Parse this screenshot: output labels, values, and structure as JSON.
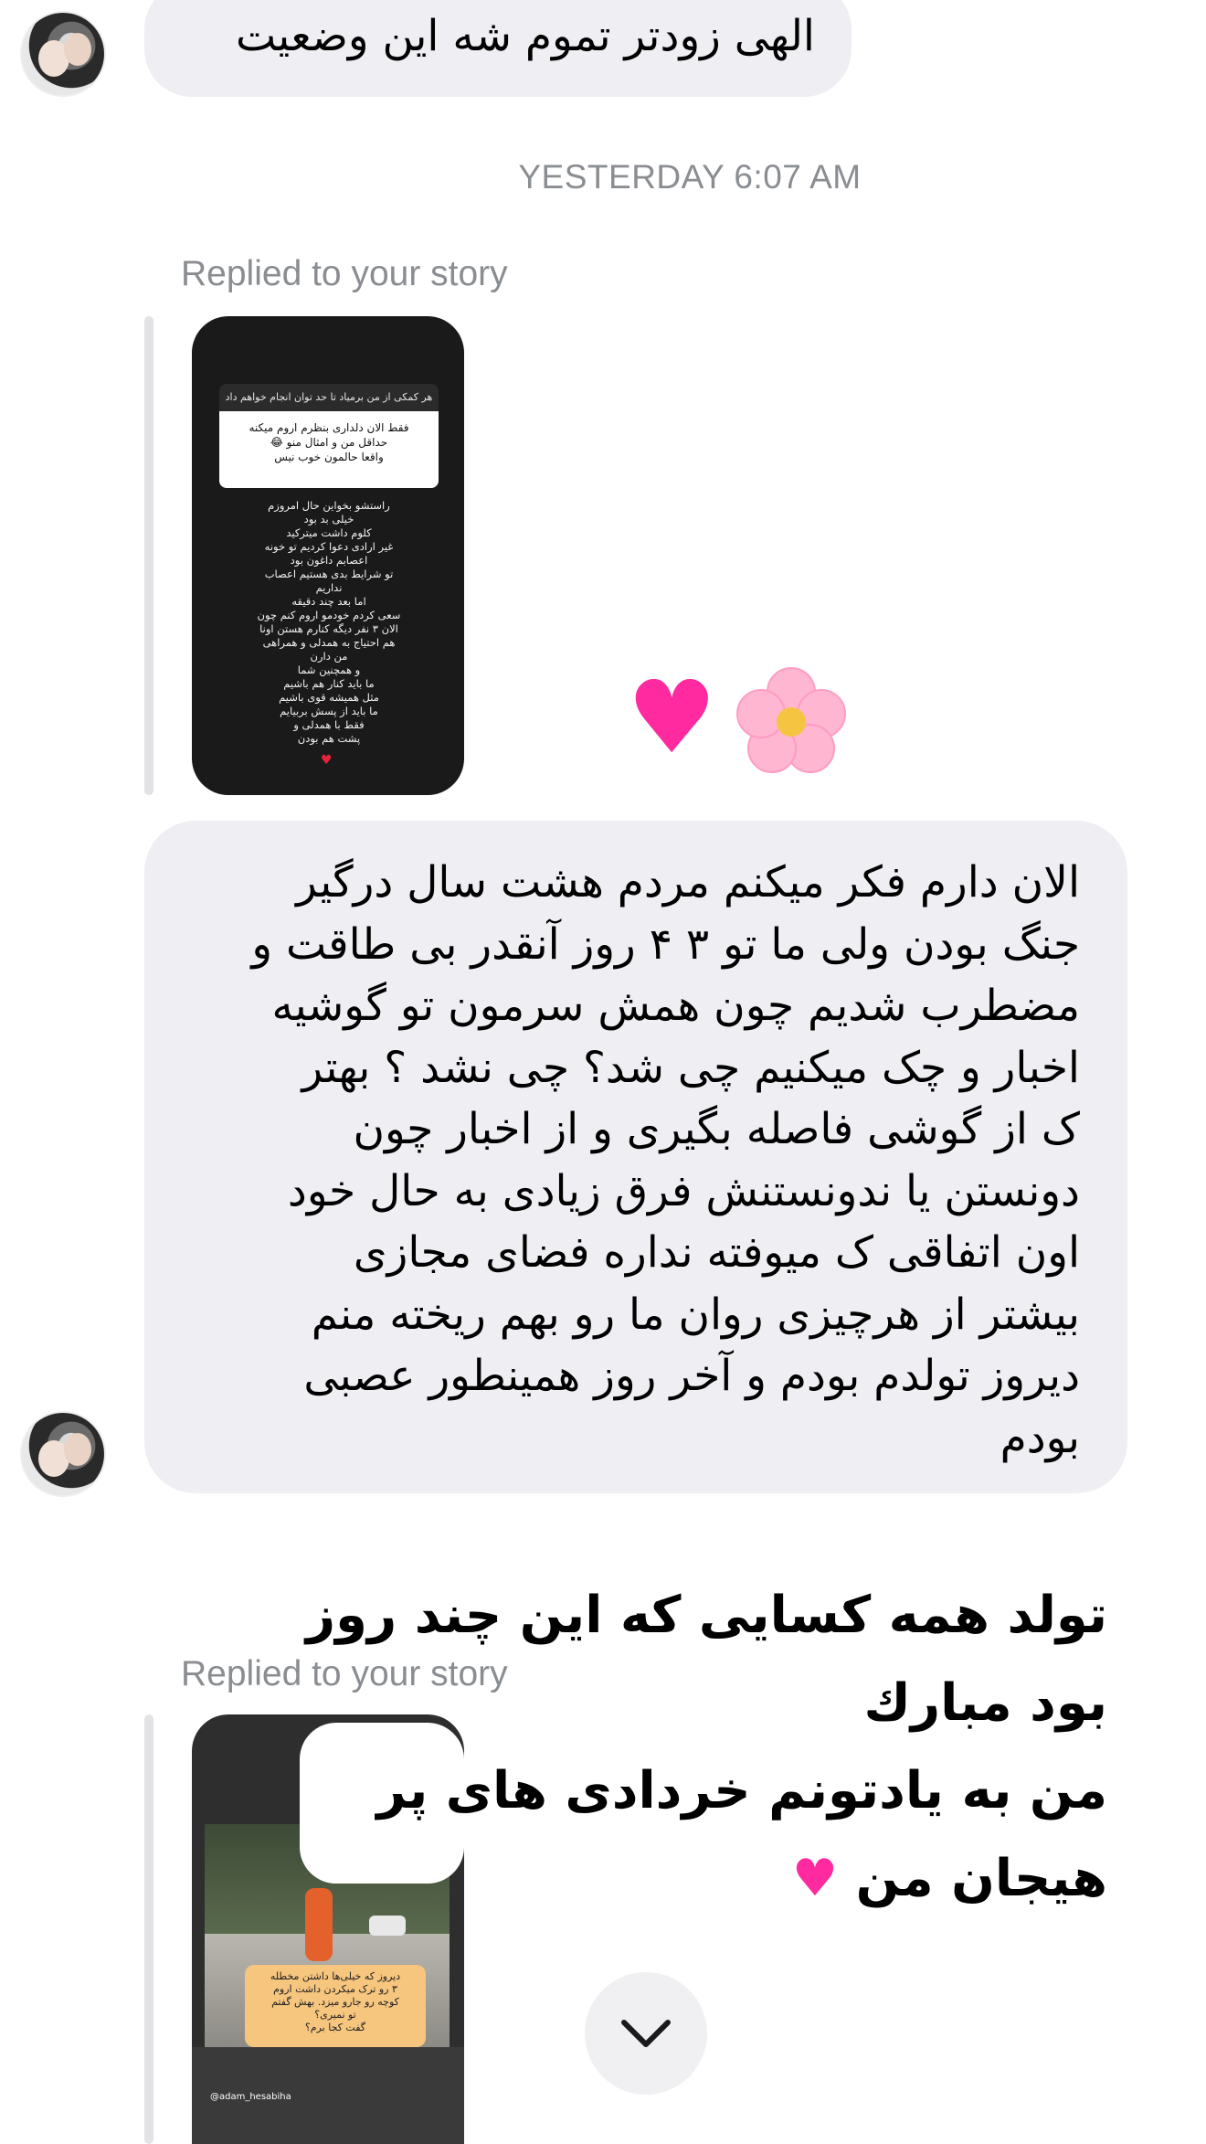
{
  "messages": [
    {
      "type": "text",
      "text": "الهی زودتر تموم شه این وضعیت"
    },
    {
      "type": "text",
      "text": "الان دارم فکر میکنم مردم هشت سال درگیر\nجنگ بودن ولی ما تو ۳ ۴ روز آنقدر بی طاقت و\nمضطرب شدیم چون همش سرمون تو گوشیه\nاخبار و چک میکنیم چی شد؟ چی نشد ؟ بهتر\nک از گوشی فاصله بگیری و از اخبار چون\nدونستن یا ندونستنش فرق زیادی به حال خود\nاون اتفاقی ک میوفته نداره فضای مجازی\nبیشتر از هرچیزی روان ما رو بهم ریخته منم\nدیروز تولدم بودم و آخر روز همینطور عصبی\nبودم"
    }
  ],
  "timestamp": "YESTERDAY 6:07 AM",
  "replies": [
    {
      "label": "Replied to your story"
    },
    {
      "label": "Replied to your story"
    }
  ],
  "story1": {
    "question_header": "هر کمکی از من برمیاد تا حد توان انجام خواهم داد",
    "answer": "فقط الان دلداری بنظرم اروم میکنه\nحداقل من و امثال منو 😂\nواقعا حالمون خوب نیس",
    "body": "راستشو بخواین حال امروزم\nخیلی بد بود\nکلوم داشت میترکید\nغیر ارادی دعوا کردیم تو خونه\nاعصابم داغون بود\nتو شرایط بدی هستیم اعصاب\nنداریم\nاما بعد چند دقیقه\nسعی کردم خودمو اروم کنم چون\nالان ۳ نفر دیگه کنارم هستن اونا\nهم احتیاج به همدلی و همراهی\nمن دارن\nو همچنین شما\nما باید کنار هم باشیم\nمثل همیشه قوی باشیم\nما باید از پسش بربیایم\nفقط با همدلی و\nپشت هم بودن",
    "heart": "♥"
  },
  "reactions": {
    "heart": "♥",
    "flower": "flower"
  },
  "story2": {
    "sticker_text": "دیروز که خیلی‌ها داشتن مخطله\n۳ رو ترک میکردن داشت اروم\nکوچه رو جارو میزد. بهش گفتم\nتو نمیری؟\nگفت کجا برم؟",
    "handle": "@adam_hesabiha"
  },
  "overlay": {
    "text": "تولد همه کسایی که این چند روز\nبود مبارك\nمن به یادتونم  خردادی های پر\nهیجان من",
    "heart": "♥"
  },
  "icons": {
    "avatar": "user-avatar",
    "scroll": "chevron-down-icon"
  },
  "colors": {
    "bubble": "#efeff3",
    "secondary_text": "#8a8d91",
    "heart": "#ff2aa0"
  }
}
